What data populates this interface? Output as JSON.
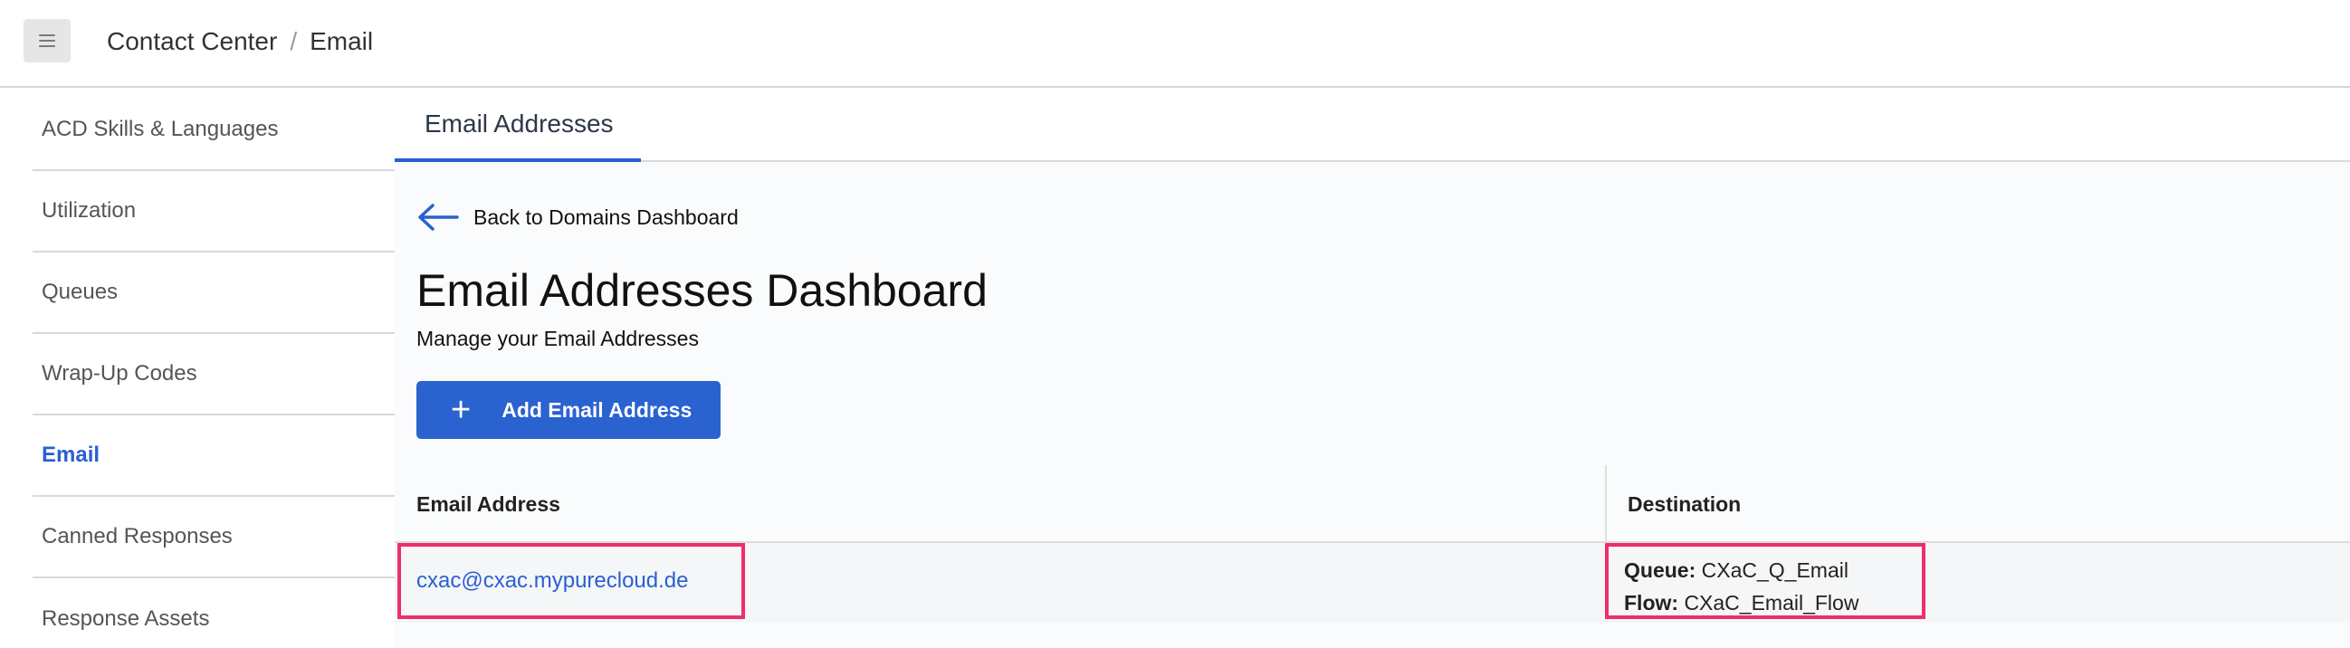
{
  "header": {
    "menu_icon": "hamburger-menu-icon",
    "breadcrumb": [
      "Contact Center",
      "Email"
    ],
    "breadcrumb_separator": "/"
  },
  "sidebar": {
    "items": [
      {
        "label": "ACD Skills & Languages",
        "active": false
      },
      {
        "label": "Utilization",
        "active": false
      },
      {
        "label": "Queues",
        "active": false
      },
      {
        "label": "Wrap-Up Codes",
        "active": false
      },
      {
        "label": "Email",
        "active": true
      },
      {
        "label": "Canned Responses",
        "active": false
      },
      {
        "label": "Response Assets",
        "active": false
      }
    ]
  },
  "main": {
    "tabs": [
      {
        "label": "Email Addresses",
        "active": true
      }
    ],
    "back_link": {
      "label": "Back to Domains Dashboard",
      "icon": "arrow-left-icon"
    },
    "title": "Email Addresses Dashboard",
    "subtitle": "Manage your Email Addresses",
    "add_button": {
      "label": "Add Email Address",
      "icon": "plus-icon"
    },
    "table": {
      "columns": [
        "Email Address",
        "Destination"
      ],
      "rows": [
        {
          "email": "cxac@cxac.mypurecloud.de",
          "queue_label": "Queue:",
          "queue_value": "CXaC_Q_Email",
          "flow_label": "Flow:",
          "flow_value": "CXaC_Email_Flow"
        }
      ]
    }
  },
  "colors": {
    "accent": "#2a62d0",
    "highlight_border": "#ef2d6e",
    "link": "#2a5fd3"
  }
}
